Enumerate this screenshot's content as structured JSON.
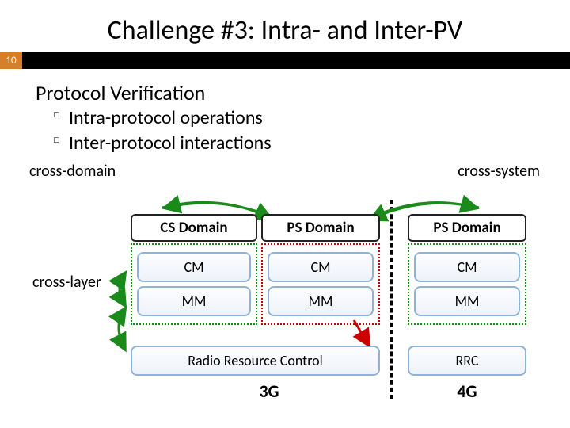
{
  "slide": {
    "title": "Challenge #3: Intra- and Inter-PV",
    "page_number": "10",
    "subtitle": "Protocol Verification",
    "bullets": [
      "Intra-protocol operations",
      "Inter-protocol interactions"
    ]
  },
  "labels": {
    "cross_domain": "cross-domain",
    "cross_system": "cross-system",
    "cross_layer": "cross-layer"
  },
  "columns": [
    {
      "header": "CS Domain",
      "cells": [
        "CM",
        "MM"
      ]
    },
    {
      "header": "PS Domain",
      "cells": [
        "CM",
        "MM"
      ]
    },
    {
      "header": "PS Domain",
      "cells": [
        "CM",
        "MM"
      ]
    }
  ],
  "rrc": {
    "wide_label": "Radio Resource Control",
    "narrow_label": "RRC"
  },
  "generations": {
    "g3": "3G",
    "g4": "4G"
  },
  "colors": {
    "green": "#1a8a1a",
    "red": "#c00",
    "blue_border": "#8fb2d9",
    "accent": "#d57f2b"
  }
}
